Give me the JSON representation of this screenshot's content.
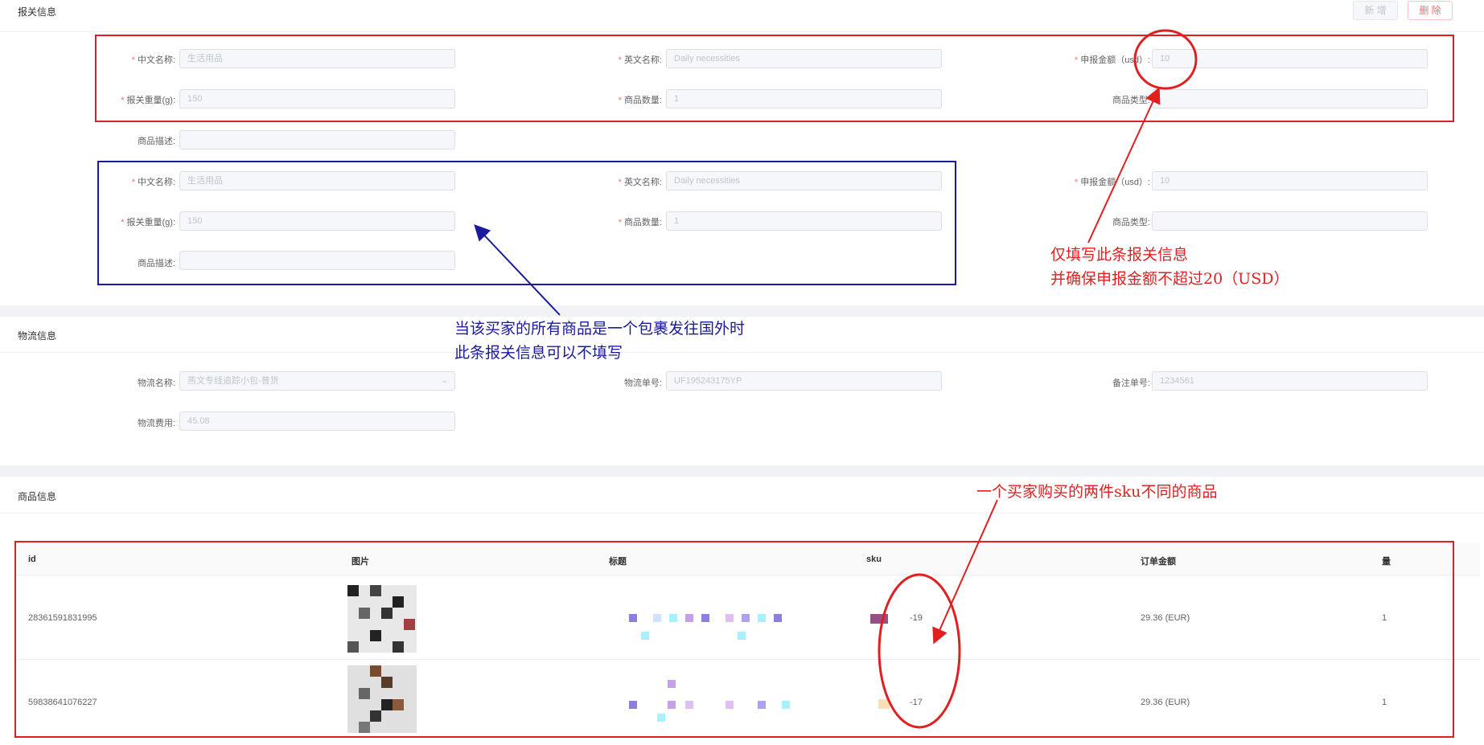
{
  "customs": {
    "section_title": "报关信息",
    "add_button": "新 增",
    "delete_button": "删 除",
    "entries": [
      {
        "cn_name_label": "中文名称:",
        "cn_name_value": "生活用品",
        "en_name_label": "英文名称:",
        "en_name_value": "Daily necessities",
        "amount_label": "申报金额（usd）:",
        "amount_value": "10",
        "weight_label": "报关重量(g):",
        "weight_value": "150",
        "qty_label": "商品数量:",
        "qty_value": "1",
        "type_label": "商品类型:",
        "type_value": "",
        "desc_label": "商品描述:",
        "desc_value": ""
      },
      {
        "cn_name_label": "中文名称:",
        "cn_name_value": "生活用品",
        "en_name_label": "英文名称:",
        "en_name_value": "Daily necessities",
        "amount_label": "申报金额（usd）:",
        "amount_value": "10",
        "weight_label": "报关重量(g):",
        "weight_value": "150",
        "qty_label": "商品数量:",
        "qty_value": "1",
        "type_label": "商品类型:",
        "type_value": "",
        "desc_label": "商品描述:",
        "desc_value": ""
      }
    ]
  },
  "logistics": {
    "section_title": "物流信息",
    "name_label": "物流名称:",
    "name_value": "燕文专线追踪小包-普货",
    "tracking_label": "物流单号:",
    "tracking_value": "UF195243175YP",
    "remark_label": "备注单号:",
    "remark_value": "1234561",
    "fee_label": "物流费用:",
    "fee_value": "45.08"
  },
  "products": {
    "section_title": "商品信息",
    "columns": [
      "id",
      "图片",
      "标题",
      "sku",
      "订单金额",
      "量"
    ],
    "rows": [
      {
        "id": "28361591831995",
        "sku": "-19",
        "amount": "29.36 (EUR)",
        "qty": "1"
      },
      {
        "id": "59838641076227",
        "sku": "-17",
        "amount": "29.36 (EUR)",
        "qty": "1"
      }
    ]
  },
  "annotations": {
    "red_note_line1": "仅填写此条报关信息",
    "red_note_line2": "并确保申报金额不超过20（USD）",
    "blue_note_line1": "当该买家的所有商品是一个包裹发往国外时",
    "blue_note_line2": "此条报关信息可以不填写",
    "sku_note": "一个买家购买的两件sku不同的商品"
  },
  "colors": {
    "annotation_red": "#e02020",
    "annotation_blue": "#1a1a9c",
    "required_star": "#f56c6c",
    "link": "#409eff"
  }
}
